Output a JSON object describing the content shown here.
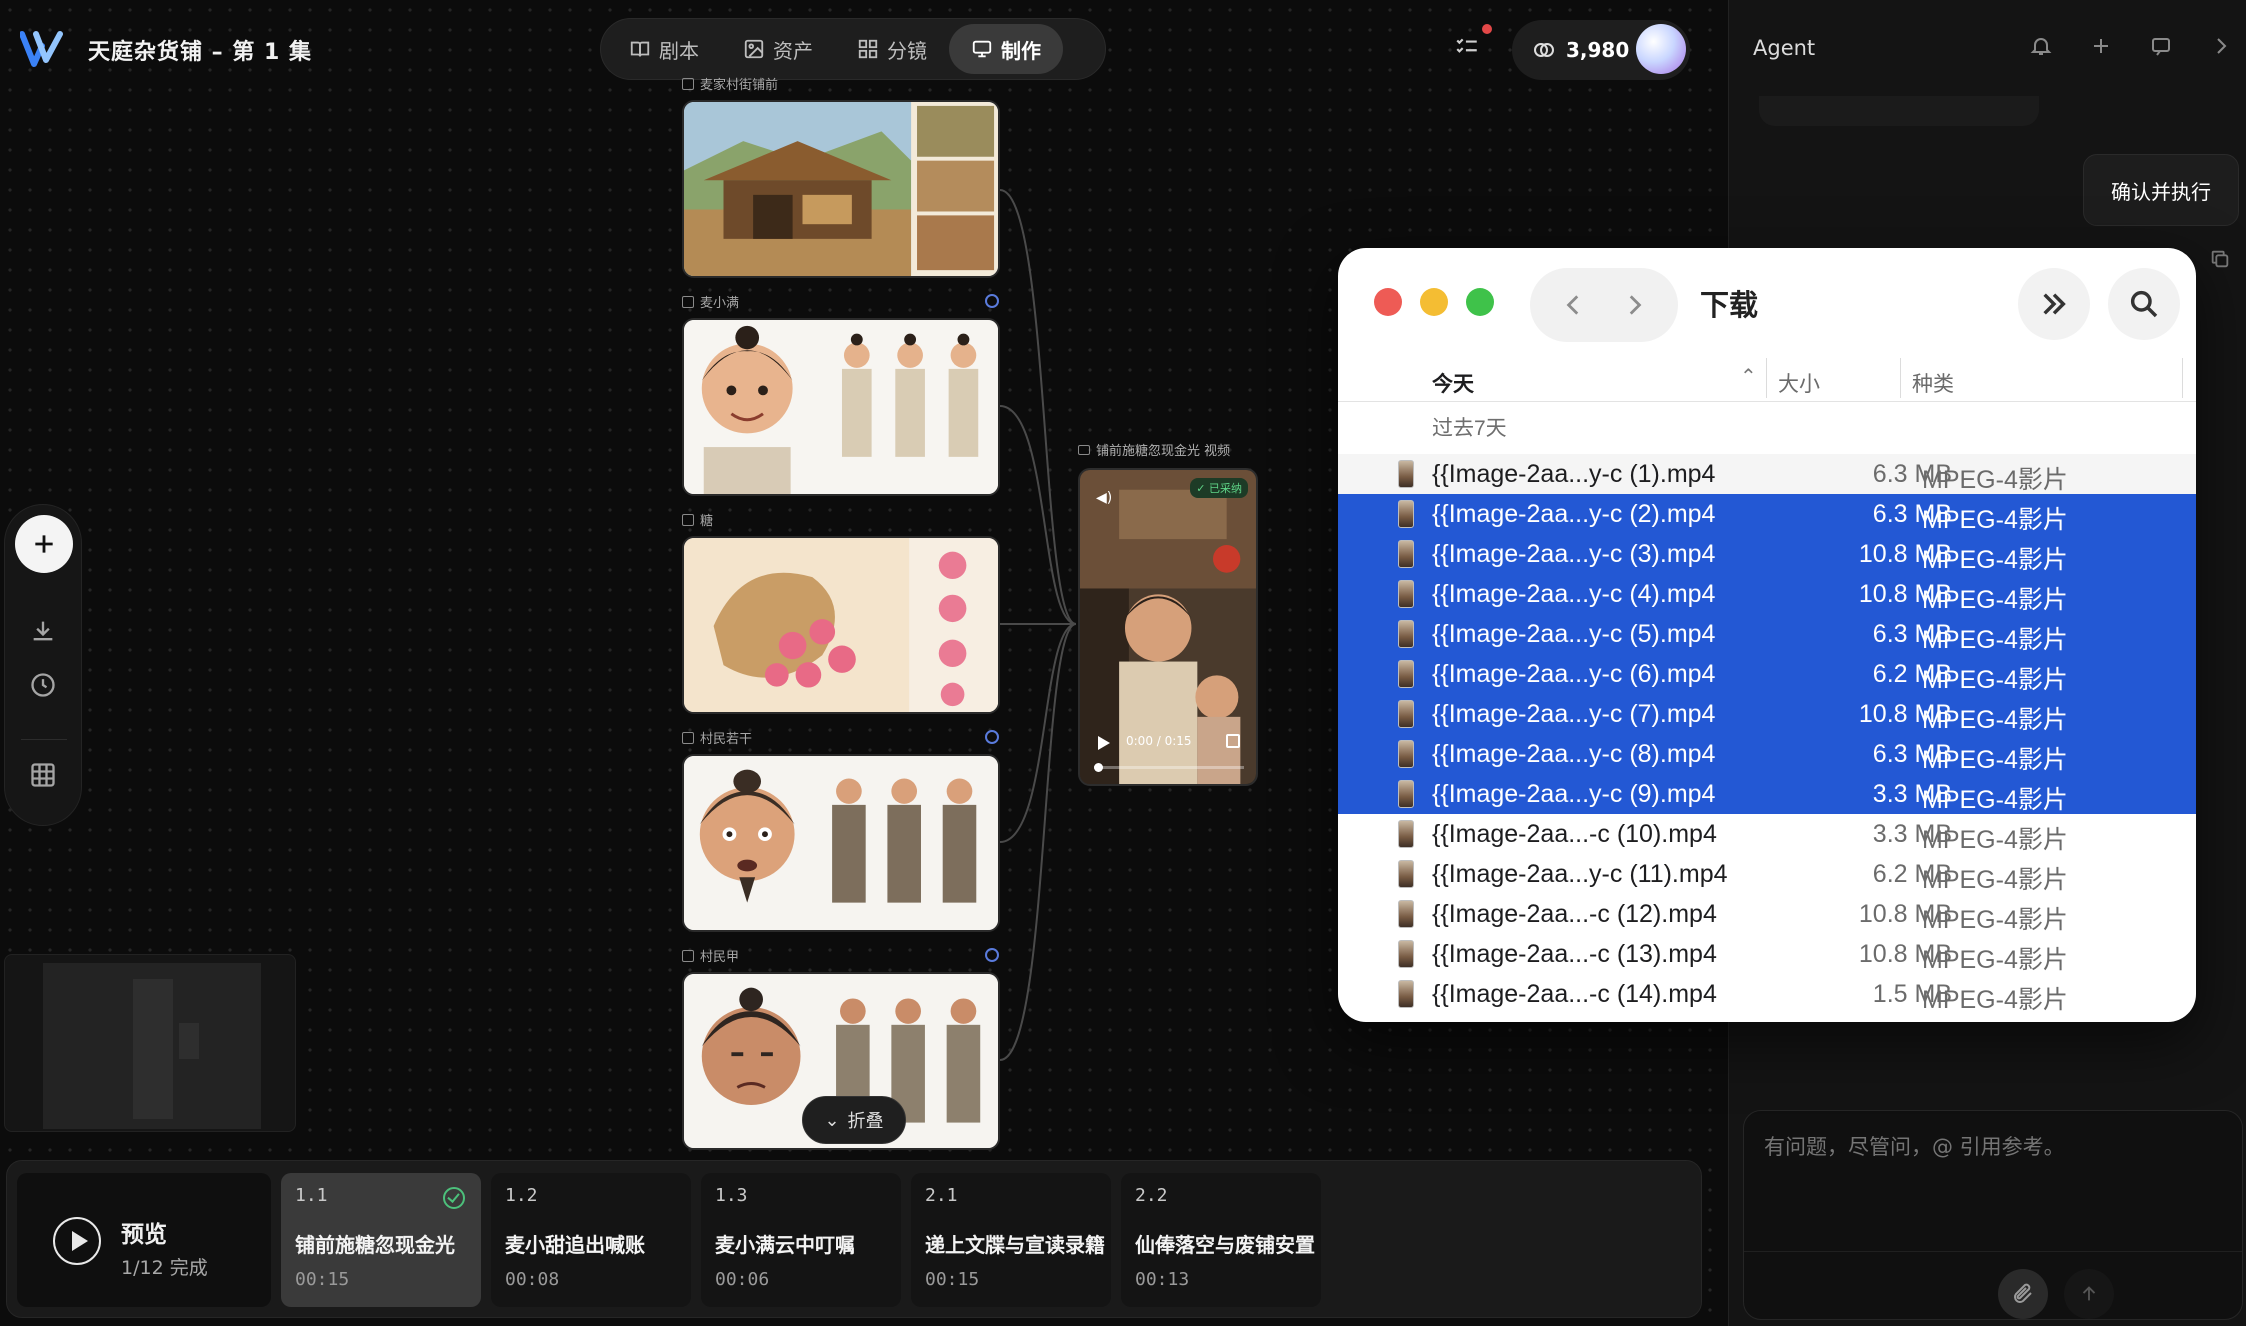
{
  "app": {
    "project_title": "天庭杂货铺 – 第 1 集",
    "nav_tabs": [
      {
        "label": "剧本",
        "icon": "book-icon",
        "active": false
      },
      {
        "label": "资产",
        "icon": "image-icon",
        "active": false
      },
      {
        "label": "分镜",
        "icon": "grid-icon",
        "active": false
      },
      {
        "label": "制作",
        "icon": "monitor-icon",
        "active": true
      }
    ],
    "credits": "3,980"
  },
  "agent": {
    "title": "Agent",
    "confirm_label": "确认并执行",
    "input_placeholder": "有问题，尽管问，@ 引用参考。"
  },
  "canvas": {
    "assets": [
      {
        "label": "麦家村街铺前",
        "verified": false
      },
      {
        "label": "麦小满",
        "verified": true
      },
      {
        "label": "糖",
        "verified": false
      },
      {
        "label": "村民若干",
        "verified": true
      },
      {
        "label": "村民甲",
        "verified": true
      }
    ],
    "video": {
      "label": "铺前施糖忽现金光 视频",
      "badge": "✓ 已采纳",
      "time": "0:00 / 0:15",
      "progress": 0.0
    },
    "collapse_label": "折叠"
  },
  "timeline": {
    "preview_title": "预览",
    "preview_status": "1/12  完成",
    "shots": [
      {
        "num": "1.1",
        "title": "铺前施糖忽现金光",
        "time": "00:15",
        "active": true,
        "done": true
      },
      {
        "num": "1.2",
        "title": "麦小甜追出喊账",
        "time": "00:08",
        "active": false,
        "done": false
      },
      {
        "num": "1.3",
        "title": "麦小满云中叮嘱",
        "time": "00:06",
        "active": false,
        "done": false
      },
      {
        "num": "2.1",
        "title": "递上文牒与宣读录籍",
        "time": "00:15",
        "active": false,
        "done": false
      },
      {
        "num": "2.2",
        "title": "仙俸落空与废铺安置",
        "time": "00:13",
        "active": false,
        "done": false
      }
    ]
  },
  "finder": {
    "title": "下载",
    "columns": {
      "name": "今天",
      "size": "大小",
      "kind": "种类"
    },
    "group": "过去7天",
    "files": [
      {
        "name": "{{Image-2aa...y-c (1).mp4",
        "size": "6.3 MB",
        "kind": "MPEG-4影片",
        "selected": false
      },
      {
        "name": "{{Image-2aa...y-c (2).mp4",
        "size": "6.3 MB",
        "kind": "MPEG-4影片",
        "selected": true
      },
      {
        "name": "{{Image-2aa...y-c (3).mp4",
        "size": "10.8 MB",
        "kind": "MPEG-4影片",
        "selected": true
      },
      {
        "name": "{{Image-2aa...y-c (4).mp4",
        "size": "10.8 MB",
        "kind": "MPEG-4影片",
        "selected": true
      },
      {
        "name": "{{Image-2aa...y-c (5).mp4",
        "size": "6.3 MB",
        "kind": "MPEG-4影片",
        "selected": true
      },
      {
        "name": "{{Image-2aa...y-c (6).mp4",
        "size": "6.2 MB",
        "kind": "MPEG-4影片",
        "selected": true
      },
      {
        "name": "{{Image-2aa...y-c (7).mp4",
        "size": "10.8 MB",
        "kind": "MPEG-4影片",
        "selected": true
      },
      {
        "name": "{{Image-2aa...y-c (8).mp4",
        "size": "6.3 MB",
        "kind": "MPEG-4影片",
        "selected": true
      },
      {
        "name": "{{Image-2aa...y-c (9).mp4",
        "size": "3.3 MB",
        "kind": "MPEG-4影片",
        "selected": true
      },
      {
        "name": "{{Image-2aa...-c (10).mp4",
        "size": "3.3 MB",
        "kind": "MPEG-4影片",
        "selected": false
      },
      {
        "name": "{{Image-2aa...y-c (11).mp4",
        "size": "6.2 MB",
        "kind": "MPEG-4影片",
        "selected": false
      },
      {
        "name": "{{Image-2aa...-c (12).mp4",
        "size": "10.8 MB",
        "kind": "MPEG-4影片",
        "selected": false
      },
      {
        "name": "{{Image-2aa...-c (13).mp4",
        "size": "10.8 MB",
        "kind": "MPEG-4影片",
        "selected": false
      },
      {
        "name": "{{Image-2aa...-c (14).mp4",
        "size": "1.5 MB",
        "kind": "MPEG-4影片",
        "selected": false
      }
    ]
  },
  "colors": {
    "selection": "#2358d4",
    "accent_green": "#4cc07b",
    "close_light": "#ee5b55",
    "minimize_light": "#f4bd33",
    "zoom_light": "#3fc24a",
    "notification_dot": "#e34848"
  }
}
